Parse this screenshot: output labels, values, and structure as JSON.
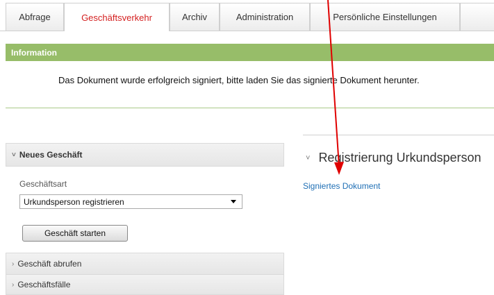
{
  "tabs": [
    {
      "label": "Abfrage"
    },
    {
      "label": "Geschäftsverkehr",
      "active": true
    },
    {
      "label": "Archiv"
    },
    {
      "label": "Administration"
    },
    {
      "label": "Persönliche Einstellungen"
    }
  ],
  "info": {
    "header": "Information",
    "message": "Das Dokument wurde erfolgreich signiert, bitte laden Sie das signierte Dokument herunter."
  },
  "left_panel": {
    "neues_geschaeft": "Neues Geschäft",
    "geschaeftsart_label": "Geschäftsart",
    "geschaeftsart_value": "Urkundsperson registrieren",
    "start_button": "Geschäft starten",
    "abrufen": "Geschäft abrufen",
    "faelle": "Geschäftsfälle"
  },
  "right_panel": {
    "title": "Registrierung Urkundsperson",
    "link": "Signiertes Dokument"
  },
  "colors": {
    "active_tab": "#d42020",
    "info_bar": "#97bd69",
    "link": "#1f6fb5",
    "annotation": "#e00000"
  }
}
